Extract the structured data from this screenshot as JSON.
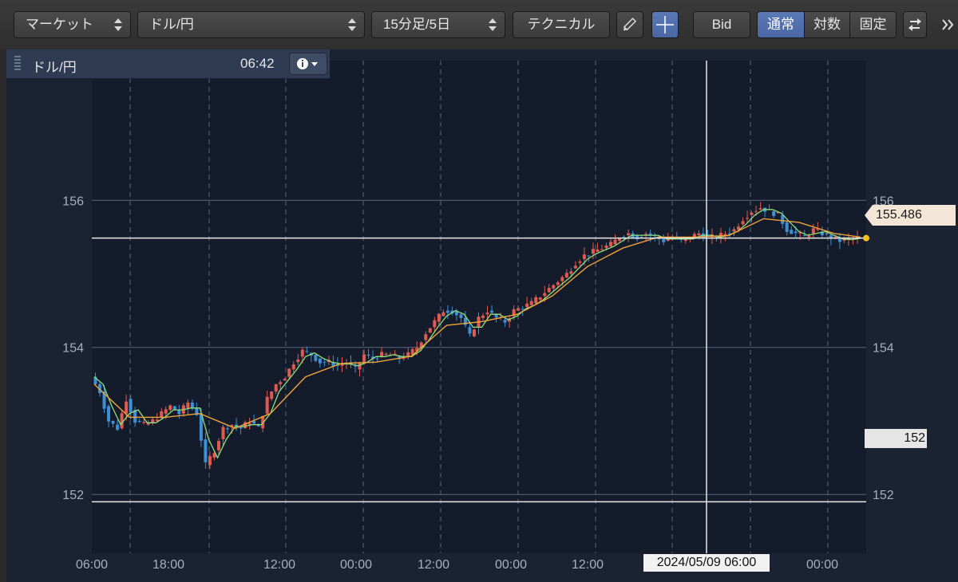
{
  "toolbar": {
    "market_label": "マーケット",
    "pair_label": "ドル/円",
    "timeframe_label": "15分足/5日",
    "technical_label": "テクニカル",
    "bid_label": "Bid",
    "scale_modes": [
      "通常",
      "対数",
      "固定"
    ],
    "scale_mode_selected": "通常",
    "icons": [
      "pencil-icon",
      "crosshair-icon",
      "toggle-icon",
      "expand-icon"
    ]
  },
  "info": {
    "symbol": "ドル/円",
    "time": "06:42"
  },
  "chart_data": {
    "type": "candlestick",
    "ylim": [
      151.2,
      157.9
    ],
    "y_ticks": [
      {
        "value": 156,
        "label": "156"
      },
      {
        "value": 154,
        "label": "154"
      },
      {
        "value": 152,
        "label": "152"
      }
    ],
    "x_ticks": [
      "06:00",
      "18:00",
      "12:00",
      "00:00",
      "12:00",
      "00:00",
      "12:00",
      "00:00"
    ],
    "current_price": "155.486",
    "current_price_value": 155.486,
    "low_line_value": 151.9,
    "low_line_label": "152",
    "crosshair_label": "2024/05/09 06:00",
    "price_path": [
      [
        0,
        153.6
      ],
      [
        2,
        153.4
      ],
      [
        4,
        153.0
      ],
      [
        6,
        152.9
      ],
      [
        8,
        153.3
      ],
      [
        10,
        153.0
      ],
      [
        12,
        152.95
      ],
      [
        14,
        153.0
      ],
      [
        16,
        153.1
      ],
      [
        18,
        153.2
      ],
      [
        20,
        153.1
      ],
      [
        22,
        153.25
      ],
      [
        24,
        153.1
      ],
      [
        26,
        152.4
      ],
      [
        28,
        152.6
      ],
      [
        30,
        152.9
      ],
      [
        32,
        152.95
      ],
      [
        34,
        152.9
      ],
      [
        36,
        153.0
      ],
      [
        38,
        152.9
      ],
      [
        40,
        153.3
      ],
      [
        42,
        153.5
      ],
      [
        44,
        153.6
      ],
      [
        46,
        153.8
      ],
      [
        48,
        153.95
      ],
      [
        50,
        153.9
      ],
      [
        52,
        153.8
      ],
      [
        54,
        153.8
      ],
      [
        56,
        153.75
      ],
      [
        58,
        153.8
      ],
      [
        60,
        153.7
      ],
      [
        62,
        153.9
      ],
      [
        64,
        153.85
      ],
      [
        66,
        153.9
      ],
      [
        68,
        153.9
      ],
      [
        70,
        153.85
      ],
      [
        72,
        153.9
      ],
      [
        74,
        154.0
      ],
      [
        76,
        154.2
      ],
      [
        78,
        154.35
      ],
      [
        80,
        154.5
      ],
      [
        82,
        154.5
      ],
      [
        84,
        154.4
      ],
      [
        86,
        154.15
      ],
      [
        88,
        154.4
      ],
      [
        90,
        154.5
      ],
      [
        92,
        154.4
      ],
      [
        94,
        154.35
      ],
      [
        96,
        154.5
      ],
      [
        98,
        154.55
      ],
      [
        100,
        154.6
      ],
      [
        102,
        154.7
      ],
      [
        104,
        154.8
      ],
      [
        106,
        154.9
      ],
      [
        108,
        155.0
      ],
      [
        110,
        155.15
      ],
      [
        112,
        155.25
      ],
      [
        114,
        155.3
      ],
      [
        116,
        155.35
      ],
      [
        118,
        155.4
      ],
      [
        120,
        155.5
      ],
      [
        122,
        155.55
      ],
      [
        124,
        155.5
      ],
      [
        126,
        155.55
      ],
      [
        128,
        155.5
      ],
      [
        130,
        155.45
      ],
      [
        132,
        155.5
      ],
      [
        134,
        155.45
      ],
      [
        136,
        155.5
      ],
      [
        138,
        155.55
      ],
      [
        140,
        155.5
      ],
      [
        142,
        155.5
      ],
      [
        144,
        155.55
      ],
      [
        146,
        155.6
      ],
      [
        148,
        155.75
      ],
      [
        150,
        155.85
      ],
      [
        152,
        155.9
      ],
      [
        154,
        155.85
      ],
      [
        156,
        155.8
      ],
      [
        158,
        155.6
      ],
      [
        160,
        155.55
      ],
      [
        162,
        155.5
      ],
      [
        164,
        155.6
      ],
      [
        166,
        155.55
      ],
      [
        168,
        155.5
      ],
      [
        170,
        155.45
      ],
      [
        172,
        155.48
      ],
      [
        174,
        155.486
      ]
    ],
    "ma_path": [
      [
        0,
        153.5
      ],
      [
        8,
        153.05
      ],
      [
        16,
        153.05
      ],
      [
        24,
        153.1
      ],
      [
        32,
        152.9
      ],
      [
        40,
        153.1
      ],
      [
        48,
        153.6
      ],
      [
        56,
        153.78
      ],
      [
        64,
        153.8
      ],
      [
        72,
        153.88
      ],
      [
        80,
        154.3
      ],
      [
        88,
        154.35
      ],
      [
        96,
        154.45
      ],
      [
        104,
        154.7
      ],
      [
        112,
        155.1
      ],
      [
        120,
        155.35
      ],
      [
        128,
        155.5
      ],
      [
        136,
        155.5
      ],
      [
        144,
        155.52
      ],
      [
        152,
        155.75
      ],
      [
        160,
        155.7
      ],
      [
        168,
        155.55
      ],
      [
        174,
        155.5
      ]
    ],
    "n_points": 174,
    "colors": {
      "up": "#e05b4f",
      "down": "#3d8fd6",
      "short_ma": "#8ee07c",
      "long_ma": "#f0a33b",
      "grid": "#5a6680",
      "horizontal_line": "#e8e8e8"
    }
  }
}
